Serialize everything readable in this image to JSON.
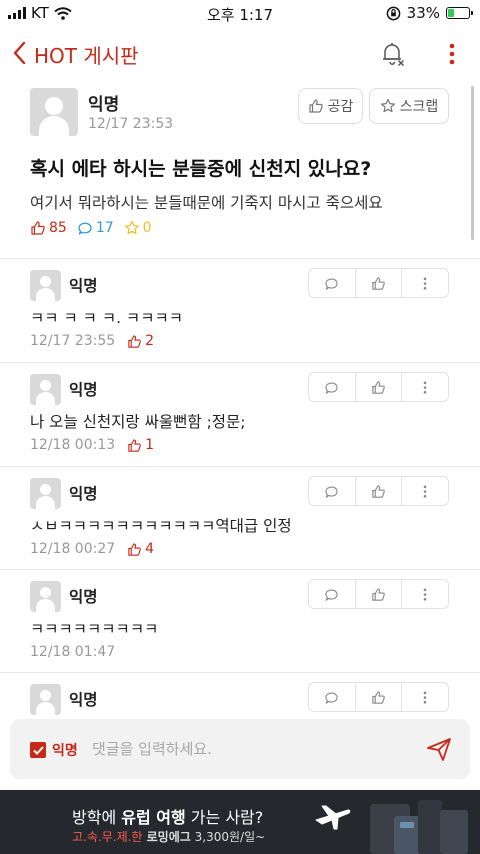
{
  "status_bar": {
    "carrier": "KT",
    "time": "오후 1:17",
    "battery": "33%",
    "battery_level": 0.33
  },
  "header": {
    "title": "HOT 게시판"
  },
  "post": {
    "author": "익명",
    "date": "12/17 23:53",
    "like_button": "공감",
    "scrap_button": "스크랩",
    "title": "혹시 에타 하시는 분들중에 신천지 있나요?",
    "body": "여기서 뭐라하시는 분들때문에 기죽지 마시고 죽으세요",
    "likes": "85",
    "comments": "17",
    "scraps": "0"
  },
  "comments": [
    {
      "author": "익명",
      "text": "ㅋㅋ ㅋ ㅋ ㅋ. ㅋㅋㅋㅋ",
      "date": "12/17 23:55",
      "likes": "2"
    },
    {
      "author": "익명",
      "text": "나 오늘 신천지랑 싸울뻔함 ;정문;",
      "date": "12/18 00:13",
      "likes": "1"
    },
    {
      "author": "익명",
      "text": "ㅅㅂㅋㅋㅋㅋㅋㅋㅋㅋㅋㅋㅋ역대급 인정",
      "date": "12/18 00:27",
      "likes": "4"
    },
    {
      "author": "익명",
      "text": "ㅋㅋㅋㅋㅋㅋㅋㅋㅋ",
      "date": "12/18 01:47",
      "likes": ""
    },
    {
      "author": "익명",
      "text": "",
      "date": "",
      "likes": ""
    }
  ],
  "comment_input": {
    "anonymous_label": "익명",
    "placeholder": "댓글을 입력하세요."
  },
  "ad": {
    "headline_pre": "방학에 ",
    "headline_bold": "유럽 여행",
    "headline_post": " 가는 사람?",
    "brand": "고.속.무.제.한",
    "product": " 로밍에그",
    "price": " 3,300원/일~"
  },
  "colors": {
    "accent": "#c62917",
    "comment_blue": "#2f9bd6",
    "scrap_yellow": "#f0c020",
    "ad_bg": "#25282d"
  },
  "icons": [
    "back-arrow-icon",
    "bell-off-icon",
    "more-vertical-icon",
    "thumbs-up-icon",
    "star-icon",
    "speech-bubble-icon",
    "send-icon",
    "airplane-icon"
  ]
}
